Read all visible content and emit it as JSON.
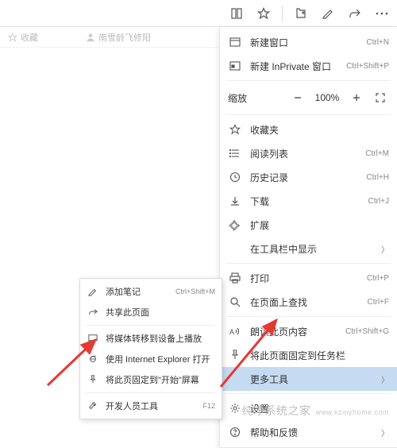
{
  "toolbar": {
    "books_icon": "books-icon",
    "star_icon": "star-icon"
  },
  "bookmarks": {
    "favorites_label": "收藏",
    "item1_label": "南雪龄飞修阳"
  },
  "main_menu": {
    "new_window": {
      "label": "新建窗口",
      "shortcut": "Ctrl+N"
    },
    "new_inprivate": {
      "label": "新建 InPrivate 窗口",
      "shortcut": "Ctrl+Shift+P"
    },
    "zoom": {
      "label": "缩放",
      "value": "100%"
    },
    "favorites": {
      "label": "收藏夹"
    },
    "reading_list": {
      "label": "阅读列表",
      "shortcut": "Ctrl+M"
    },
    "history": {
      "label": "历史记录",
      "shortcut": "Ctrl+H"
    },
    "downloads": {
      "label": "下载",
      "shortcut": "Ctrl+J"
    },
    "extensions": {
      "label": "扩展"
    },
    "show_in_toolbar": {
      "label": "在工具栏中显示"
    },
    "print": {
      "label": "打印",
      "shortcut": "Ctrl+P"
    },
    "find": {
      "label": "在页面上查找",
      "shortcut": "Ctrl+F"
    },
    "read_aloud": {
      "label": "朗读此页内容",
      "shortcut": "Ctrl+Shift+G"
    },
    "pin_taskbar": {
      "label": "将此页面固定到任务栏"
    },
    "more_tools": {
      "label": "更多工具"
    },
    "settings": {
      "label": "设置"
    },
    "help": {
      "label": "帮助和反馈"
    }
  },
  "submenu": {
    "add_notes": {
      "label": "添加笔记",
      "shortcut": "Ctrl+Shift+M"
    },
    "share": {
      "label": "共享此页面"
    },
    "cast": {
      "label": "将媒体转移到设备上播放"
    },
    "open_ie": {
      "label": "使用 Internet Explorer 打开"
    },
    "pin_start": {
      "label": "将此页固定到\"开始\"屏幕"
    },
    "dev_tools": {
      "label": "开发人员工具",
      "shortcut": "F12"
    }
  },
  "watermark": {
    "brand": "纯净系统之家",
    "url": "www.kzmyhome.com"
  }
}
